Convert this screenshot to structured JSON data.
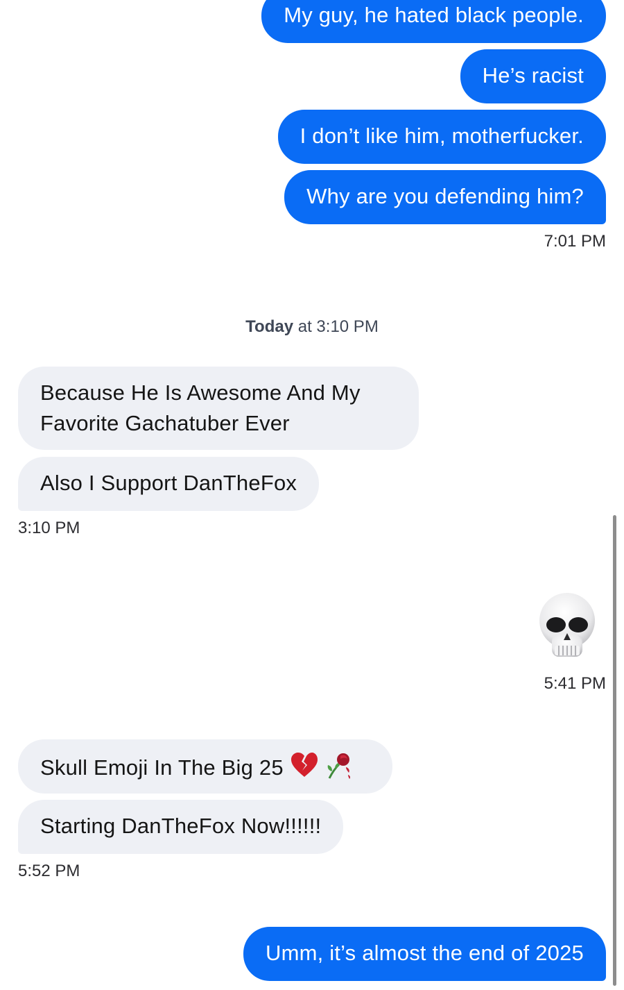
{
  "messages": {
    "sent1": "My guy, he hated black people.",
    "sent2": "He’s racist",
    "sent3": "I don’t like him, motherfucker.",
    "sent4": "Why are you defending him?",
    "ts1": "7:01 PM",
    "day_separator_bold": "Today",
    "day_separator_rest": " at 3:10 PM",
    "recv1_line1": "Because He Is Awesome And My",
    "recv1_line2": "Favorite Gachatuber Ever",
    "recv2": "Also I Support DanTheFox",
    "ts2": "3:10 PM",
    "ts3": "5:41 PM",
    "recv3": "Skull Emoji In The Big 25",
    "recv4": "Starting DanTheFox Now!!!!!!",
    "ts4": "5:52 PM",
    "sent5": "Umm, it’s almost the end of 2025"
  },
  "emojis": {
    "big_emoji": "skull-emoji",
    "inline_1": "broken-heart-emoji",
    "inline_2": "wilted-rose-emoji"
  },
  "colors": {
    "sent_bubble": "#0a6cf5",
    "received_bubble": "#eef0f5"
  }
}
